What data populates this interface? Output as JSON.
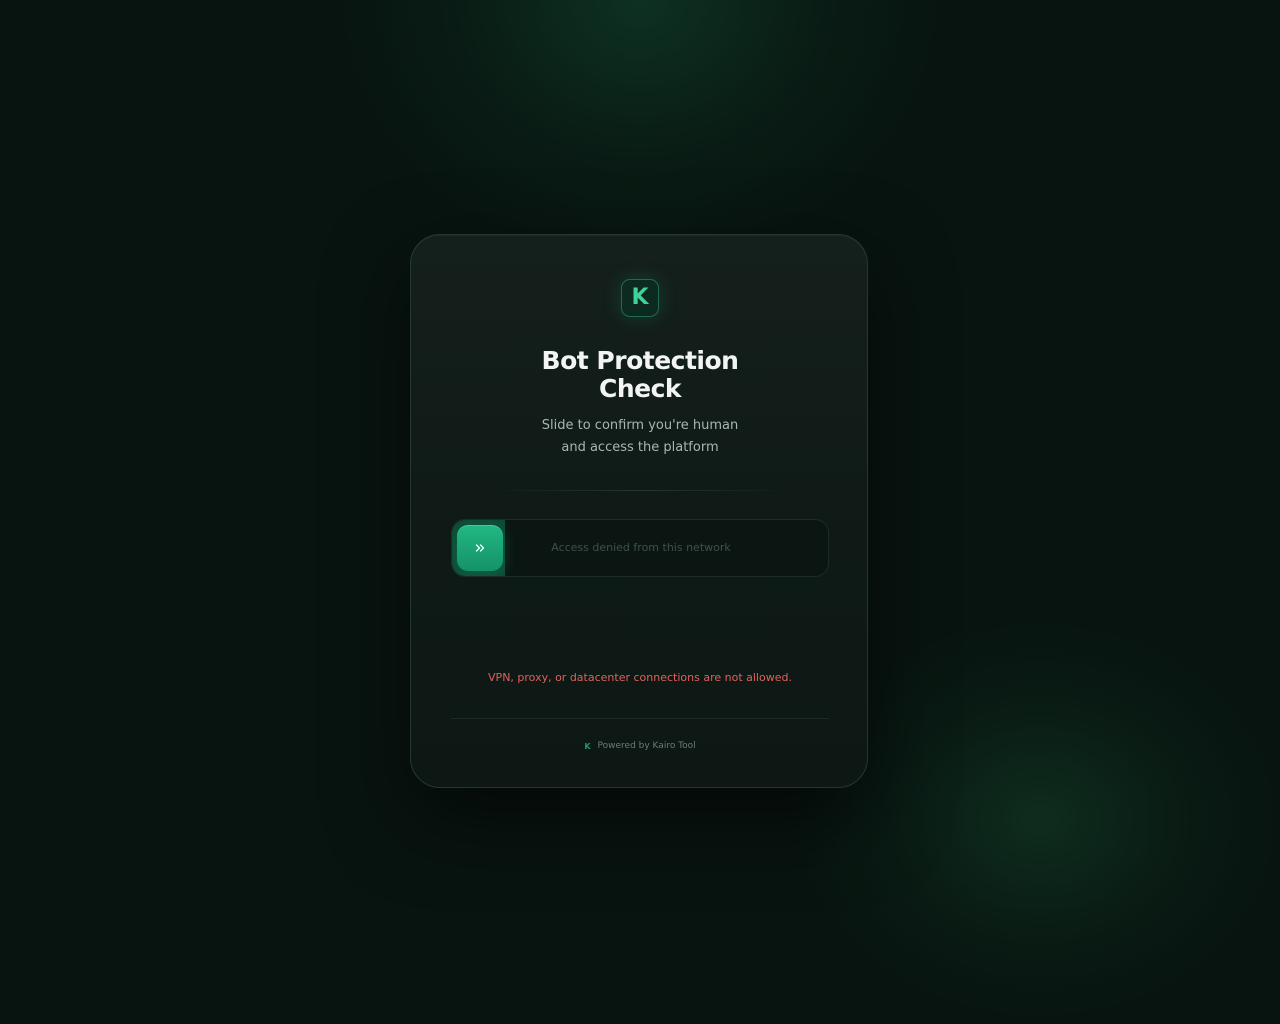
{
  "brand": {
    "logo_letter": "K",
    "accent_color": "#1fa874"
  },
  "card": {
    "title": "Bot Protection\nCheck",
    "subtitle": "Slide to confirm you're human\nand access the platform"
  },
  "slider": {
    "label": "Access denied from this network",
    "progress": 0.14,
    "handle_icon": "double-chevron-right-icon"
  },
  "error": {
    "message": "VPN, proxy, or datacenter connections are not allowed.",
    "color": "#e0605c"
  },
  "footer": {
    "icon_letter": "K",
    "text": "Powered by Kairo Tool"
  }
}
